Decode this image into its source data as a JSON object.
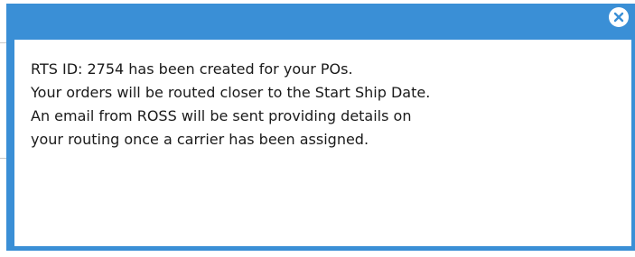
{
  "dialog": {
    "accent_color": "#3a8fd6",
    "close_icon": "close-circle-icon",
    "message_lines": [
      "RTS ID: 2754 has been created for your POs.",
      "Your orders will be routed closer to the Start Ship Date.",
      "An email from ROSS will be sent providing details on",
      "your routing once a carrier has been assigned."
    ]
  }
}
